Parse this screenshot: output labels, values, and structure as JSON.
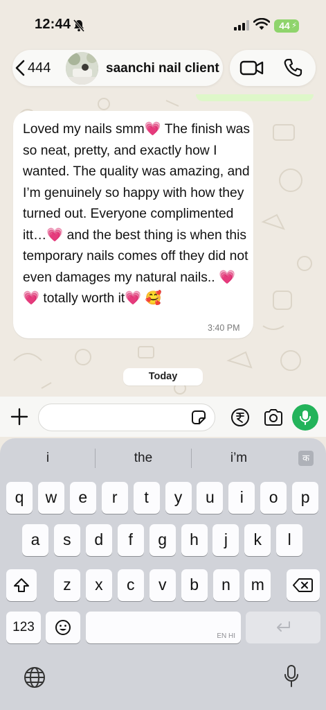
{
  "status_bar": {
    "time": "12:44",
    "battery": "44"
  },
  "header": {
    "back_count": "444",
    "contact_name": "saanchi nail client"
  },
  "chat": {
    "message_text": "Loved my nails smm💗 The finish was so neat, pretty, and exactly how I wanted. The quality was amazing, and I’m genuinely so happy with how they turned out. Everyone complimented itt…💗 and the best thing is when this temporary nails comes off they did not even damages my natural nails.. 💗 💗 totally worth it💗 🥰",
    "message_time": "3:40 PM",
    "date_chip": "Today"
  },
  "input": {
    "placeholder": ""
  },
  "keyboard": {
    "suggestions": [
      "i",
      "the",
      "i’m"
    ],
    "lang_badge": "क",
    "row1": [
      "q",
      "w",
      "e",
      "r",
      "t",
      "y",
      "u",
      "i",
      "o",
      "p"
    ],
    "row2": [
      "a",
      "s",
      "d",
      "f",
      "g",
      "h",
      "j",
      "k",
      "l"
    ],
    "row3": [
      "z",
      "x",
      "c",
      "v",
      "b",
      "n",
      "m"
    ],
    "num_label": "123",
    "space_lang": "EN HI"
  },
  "colors": {
    "accent": "#23b35a",
    "battery": "#8fd46c",
    "chat_bg": "#efeae2"
  }
}
